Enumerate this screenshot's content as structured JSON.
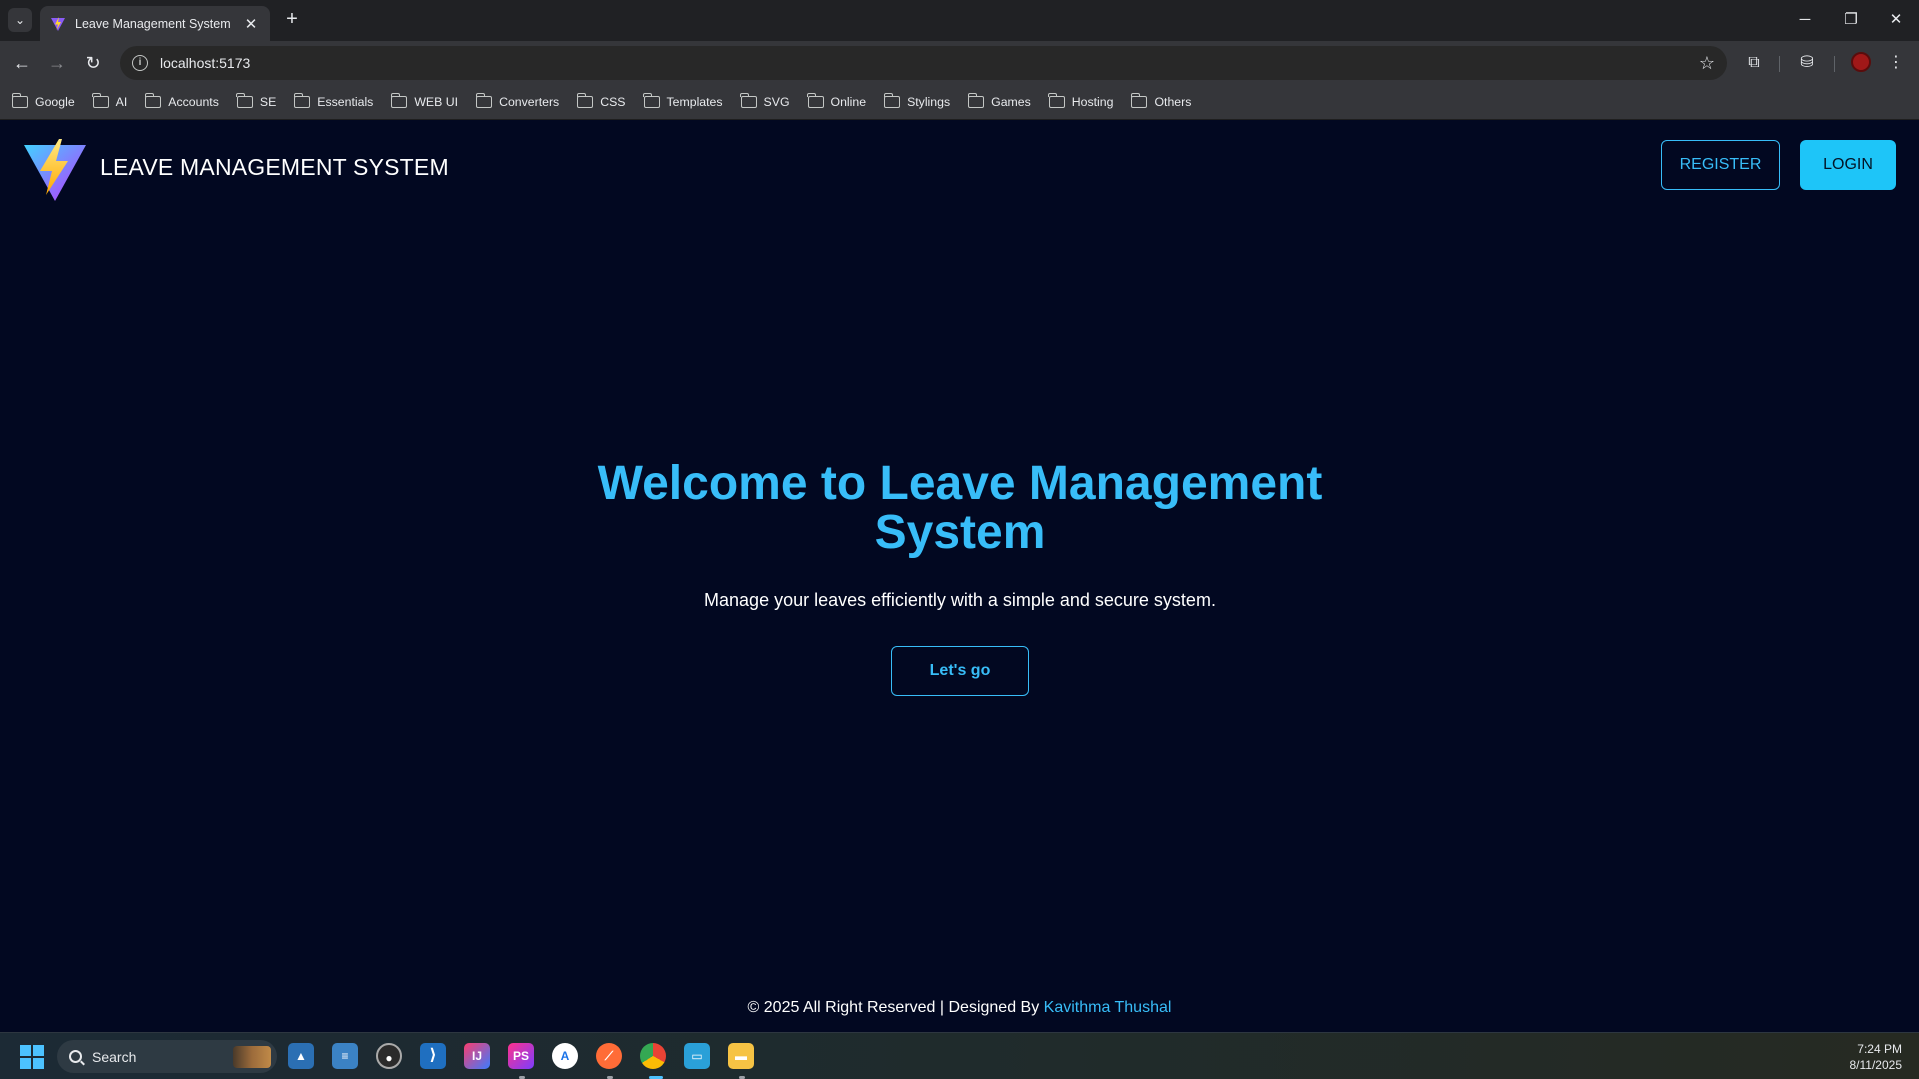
{
  "browser": {
    "tab_title": "Leave Management System",
    "tab_close": "✕",
    "new_tab": "+",
    "url": "localhost:5173",
    "window_controls": {
      "minimize": "─",
      "restore": "❐",
      "close": "✕"
    },
    "bookmarks": [
      "Google",
      "AI",
      "Accounts",
      "SE",
      "Essentials",
      "WEB UI",
      "Converters",
      "CSS",
      "Templates",
      "SVG",
      "Online",
      "Stylings",
      "Games",
      "Hosting",
      "Others"
    ]
  },
  "page": {
    "site_title": "LEAVE MANAGEMENT SYSTEM",
    "register_label": "REGISTER",
    "login_label": "LOGIN",
    "hero_title": "Welcome to Leave Management System",
    "hero_subtitle": "Manage your leaves efficiently with a simple and secure system.",
    "cta_label": "Let's go",
    "footer_prefix": "© 2025 All Right Reserved | Designed By ",
    "footer_author": "Kavithma Thushal"
  },
  "taskbar": {
    "search_placeholder": "Search",
    "time": "7:24 PM",
    "date": "8/11/2025"
  },
  "colors": {
    "accent": "#38bdf8",
    "login_bg": "#1ec5f8",
    "page_bg": "#020821"
  }
}
